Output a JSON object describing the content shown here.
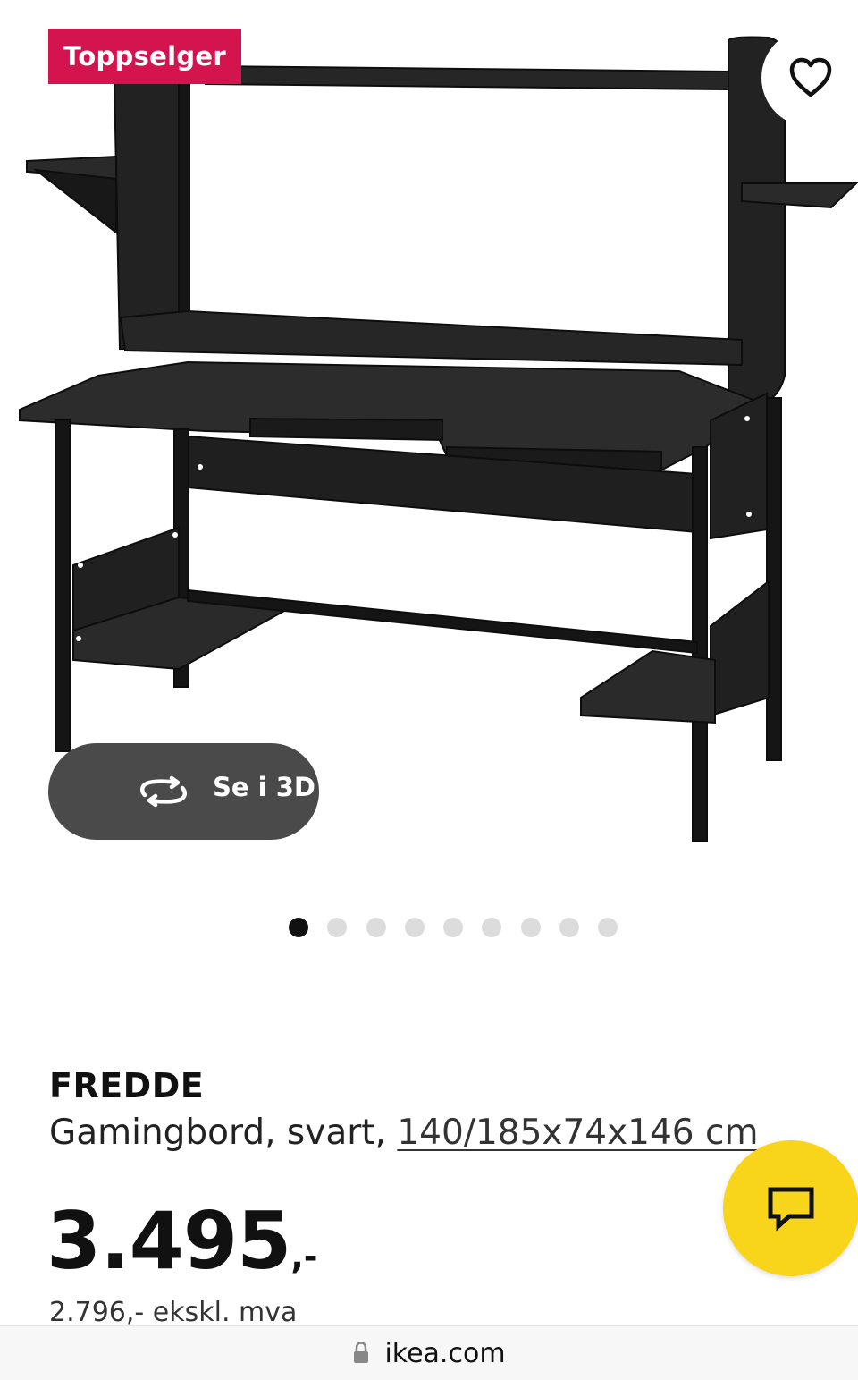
{
  "badge": "Toppselger",
  "view3d": {
    "label": "Se i 3D",
    "icon": "rotate-3d-icon"
  },
  "gallery": {
    "image_count": 9,
    "active_index": 0
  },
  "product": {
    "name": "FREDDE",
    "desc_prefix": "Gamingbord, svart, ",
    "dimensions": "140/185x74x146 cm",
    "price_main": "3.495",
    "price_suffix": ",-",
    "price_ex_vat": "2.796,- ekskl. mva"
  },
  "browser": {
    "url": "ikea.com"
  },
  "colors": {
    "badge": "#d4144f",
    "chat": "#f8d51b",
    "view3d_bg": "#4a4a4a"
  }
}
